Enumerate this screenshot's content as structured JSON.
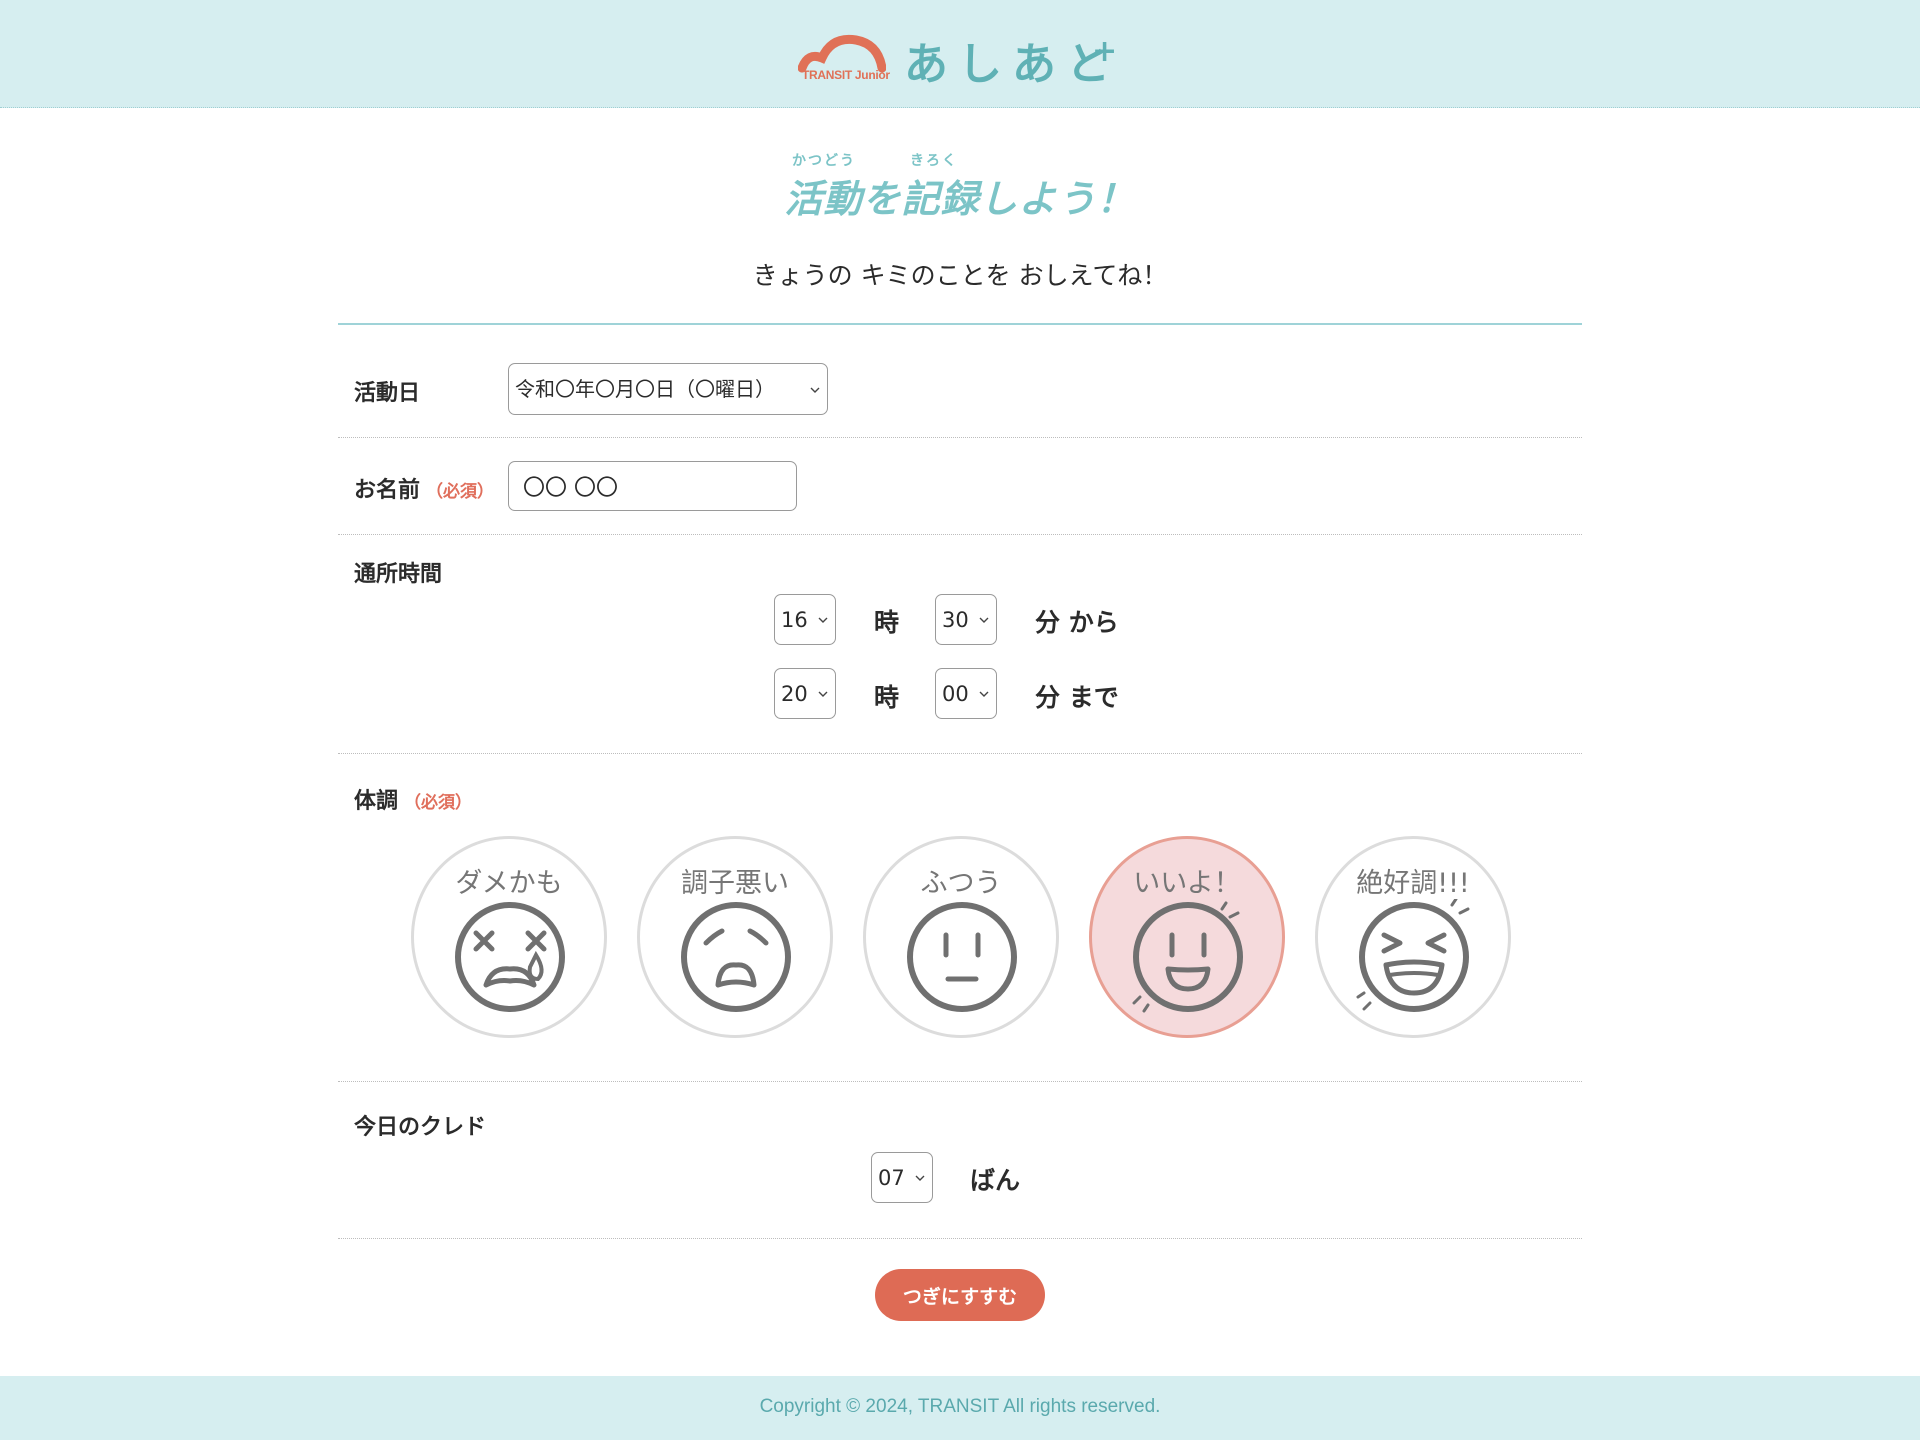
{
  "header": {
    "logo_text": "あしあと",
    "logo_plus": "+",
    "logo_sub": "TRANSIT Junior"
  },
  "title": {
    "ruby_1": "かつどう",
    "ruby_2": "きろく",
    "main": "活動を記録しよう！",
    "subtitle": "きょうの キミのことを おしえてね！"
  },
  "form": {
    "date": {
      "label": "活動日",
      "value": "令和〇年〇月〇日（〇曜日）"
    },
    "name": {
      "label": "お名前",
      "required": "（必須）",
      "value": "〇〇 〇〇"
    },
    "time": {
      "label": "通所時間",
      "start_hour": "16",
      "start_minute": "30",
      "end_hour": "20",
      "end_minute": "00",
      "hour_unit": "時",
      "from_suffix": "分 から",
      "to_suffix": "分 まで"
    },
    "condition": {
      "label": "体調",
      "required": "（必須）",
      "options": [
        {
          "label": "ダメかも",
          "icon": "dizzy-face-icon"
        },
        {
          "label": "調子悪い",
          "icon": "sad-face-icon"
        },
        {
          "label": "ふつう",
          "icon": "neutral-face-icon"
        },
        {
          "label": "いいよ！",
          "icon": "smile-face-icon"
        },
        {
          "label": "絶好調!!!",
          "icon": "laughing-face-icon"
        }
      ],
      "selected_index": 3
    },
    "cred": {
      "label": "今日のクレド",
      "value": "07",
      "suffix": "ばん"
    },
    "next_label": "つぎにすすむ"
  },
  "footer": {
    "copyright": "Copyright © 2024, TRANSIT All rights reserved."
  },
  "colors": {
    "header_bg": "#d6eef0",
    "accent_teal": "#7cc4c7",
    "accent_orange": "#de6b55",
    "selected_bg": "#f5dadc"
  }
}
